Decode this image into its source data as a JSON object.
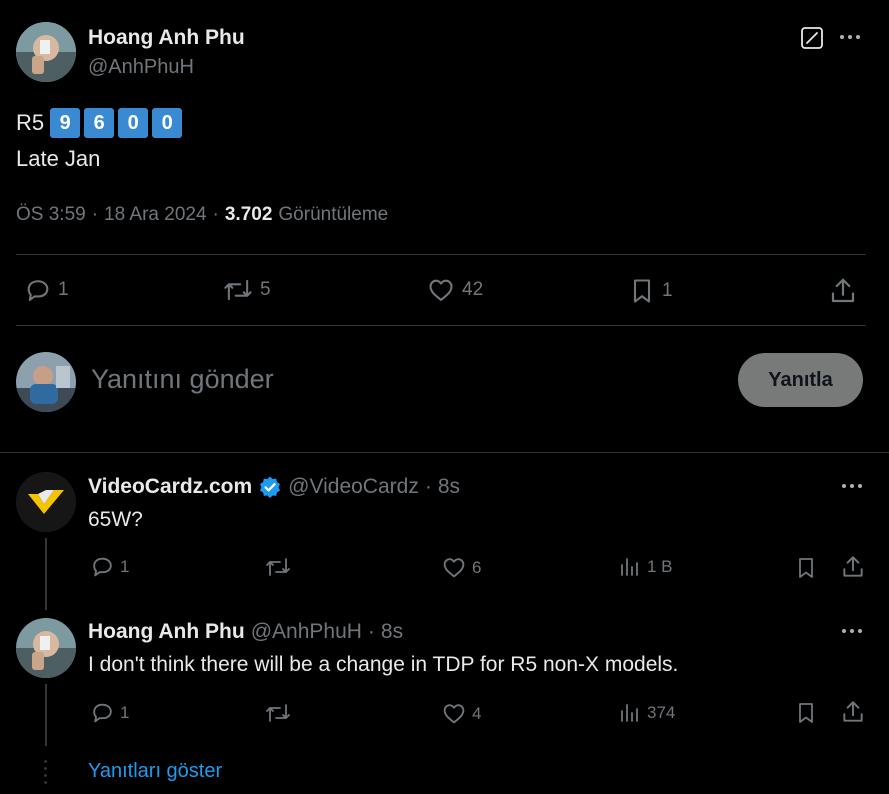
{
  "tweet": {
    "author_name": "Hoang Anh Phu",
    "author_handle": "@AnhPhuH",
    "text_prefix": "R5",
    "keycaps": [
      "9",
      "6",
      "0",
      "0"
    ],
    "text_line2": "Late Jan",
    "meta": {
      "time": "ÖS 3:59",
      "sep1": "·",
      "date": "18 Ara 2024",
      "sep2": "·",
      "views": "3.702",
      "views_label": "Görüntüleme"
    },
    "actions": {
      "replies": "1",
      "retweets": "5",
      "likes": "42",
      "bookmarks": "1"
    }
  },
  "composer": {
    "placeholder": "Yanıtını gönder",
    "button_label": "Yanıtla"
  },
  "replies": [
    {
      "author_name": "VideoCardz.com",
      "verified": true,
      "author_handle": "@VideoCardz",
      "sep": "·",
      "time": "8s",
      "text": "65W?",
      "actions": {
        "replies": "1",
        "retweets": "",
        "likes": "6",
        "views": "1 B"
      }
    },
    {
      "author_name": "Hoang Anh Phu",
      "verified": false,
      "author_handle": "@AnhPhuH",
      "sep": "·",
      "time": "8s",
      "text": "I don't think there will be a change in TDP for R5 non-X models.",
      "actions": {
        "replies": "1",
        "retweets": "",
        "likes": "4",
        "views": "374"
      }
    }
  ],
  "show_replies": "Yanıtları göster",
  "colors": {
    "background": "#000000",
    "text": "#e7e9ea",
    "muted": "#71767b",
    "link": "#1d9bf0",
    "verified": "#1d9bf0",
    "keycap": "#3a8ad3",
    "button_bg": "#787a7a"
  },
  "icons": {
    "edit": "edit-icon",
    "more": "more-icon",
    "reply": "reply-icon",
    "retweet": "retweet-icon",
    "like": "heart-icon",
    "bookmark": "bookmark-icon",
    "share": "share-icon",
    "views": "analytics-icon",
    "verified": "verified-badge-icon"
  }
}
